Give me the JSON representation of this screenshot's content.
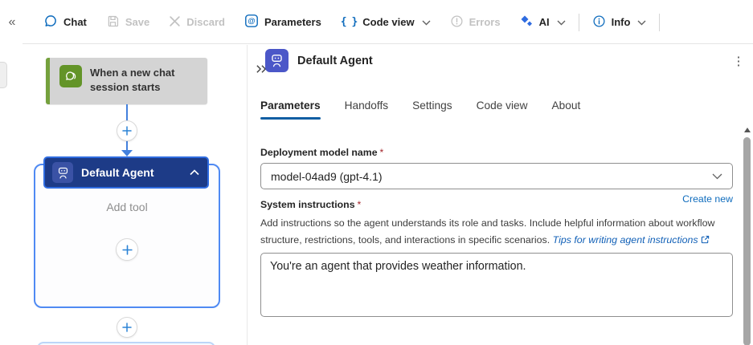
{
  "icons": {
    "collapse_left": "«",
    "expand_panel": "»",
    "more_vertical": "⋮",
    "code_braces": "{ }"
  },
  "toolbar": {
    "chat": "Chat",
    "save": "Save",
    "discard": "Discard",
    "parameters": "Parameters",
    "code_view": "Code view",
    "errors": "Errors",
    "ai": "AI",
    "info": "Info"
  },
  "canvas": {
    "trigger": {
      "title_line1": "When a new chat",
      "title_line2": "session starts"
    },
    "agent": {
      "title": "Default Agent",
      "placeholder": "Add tool"
    }
  },
  "panel": {
    "title": "Default Agent",
    "tabs": [
      {
        "label": "Parameters",
        "active": true
      },
      {
        "label": "Handoffs",
        "active": false
      },
      {
        "label": "Settings",
        "active": false
      },
      {
        "label": "Code view",
        "active": false
      },
      {
        "label": "About",
        "active": false
      }
    ],
    "form": {
      "required_marker": "*",
      "model_label": "Deployment model name",
      "model_value": "model-04ad9 (gpt-4.1)",
      "create_new_link": "Create new",
      "instructions_label": "System instructions",
      "instructions_description": "Add instructions so the agent understands its role and tasks. Include helpful information about workflow structure, restrictions, tools, and interactions in specific scenarios.",
      "tips_link": "Tips for writing agent instructions",
      "instructions_value": "You're an agent that provides weather information."
    }
  },
  "colors": {
    "accent_blue": "#0f6cbd",
    "tab_underline": "#115ea3",
    "trigger_green_stripe": "#75a13d",
    "trigger_green_icon": "#639428",
    "agent_header_navy": "#1d3b87",
    "agent_icon_indigo": "#4b57c8",
    "node_border_blue": "#4f8af3",
    "connector_blue": "#4380dd",
    "required_red": "#a4262c"
  }
}
